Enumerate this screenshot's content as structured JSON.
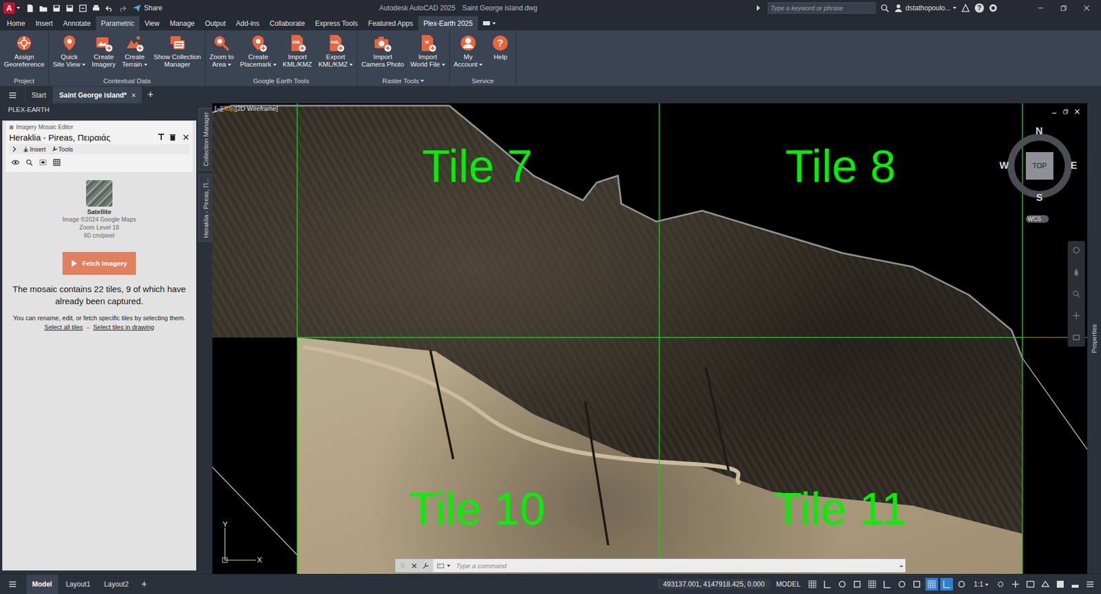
{
  "title_bar": {
    "logo": "A",
    "share": "Share",
    "title": [
      "Autodesk AutoCAD 2025",
      "Saint George island.dwg"
    ],
    "search_placeholder": "Type a keyword or phrase",
    "user": "dstathopoulo...",
    "help": "?"
  },
  "ribbon_tabs": [
    {
      "label": "Home",
      "selected": false,
      "highlighted": false
    },
    {
      "label": "Insert",
      "selected": false,
      "highlighted": false
    },
    {
      "label": "Annotate",
      "selected": false,
      "highlighted": false
    },
    {
      "label": "Parametric",
      "selected": false,
      "highlighted": true
    },
    {
      "label": "View",
      "selected": false,
      "highlighted": false
    },
    {
      "label": "Manage",
      "selected": false,
      "highlighted": false
    },
    {
      "label": "Output",
      "selected": false,
      "highlighted": false
    },
    {
      "label": "Add-ins",
      "selected": false,
      "highlighted": false
    },
    {
      "label": "Collaborate",
      "selected": false,
      "highlighted": false
    },
    {
      "label": "Express Tools",
      "selected": false,
      "highlighted": false
    },
    {
      "label": "Featured Apps",
      "selected": false,
      "highlighted": false
    },
    {
      "label": "Plex-Earth 2025",
      "selected": true,
      "highlighted": false
    }
  ],
  "ribbon_groups": [
    {
      "title": "Project",
      "dropdown": false,
      "buttons": [
        {
          "lines": [
            "Assign",
            "Georeference"
          ],
          "dropdown": false
        }
      ]
    },
    {
      "title": "Contextual Data",
      "dropdown": false,
      "buttons": [
        {
          "lines": [
            "Quick",
            "Site View"
          ],
          "dropdown": true
        },
        {
          "lines": [
            "Create",
            "Imagery"
          ],
          "dropdown": false
        },
        {
          "lines": [
            "Create",
            "Terrain"
          ],
          "dropdown": true
        },
        {
          "lines": [
            "Show Collection",
            "Manager"
          ],
          "dropdown": false
        }
      ]
    },
    {
      "title": "Google Earth Tools",
      "dropdown": false,
      "buttons": [
        {
          "lines": [
            "Zoom to",
            "Area"
          ],
          "dropdown": true
        },
        {
          "lines": [
            "Create",
            "Placemark"
          ],
          "dropdown": true
        },
        {
          "lines": [
            "Import",
            "KML/KMZ"
          ],
          "dropdown": false,
          "badge": "KML"
        },
        {
          "lines": [
            "Export",
            "KML/KMZ"
          ],
          "dropdown": true,
          "badge": "KML"
        }
      ]
    },
    {
      "title": "Raster Tools",
      "dropdown": true,
      "buttons": [
        {
          "lines": [
            "Import",
            "Camera Photo"
          ],
          "dropdown": false
        },
        {
          "lines": [
            "Import",
            "World File"
          ],
          "dropdown": true,
          "badge": "W"
        }
      ]
    },
    {
      "title": "Service",
      "dropdown": false,
      "buttons": [
        {
          "lines": [
            "My",
            "Account"
          ],
          "dropdown": true
        },
        {
          "lines": [
            "Help"
          ],
          "dropdown": false,
          "glyph": "?"
        }
      ]
    }
  ],
  "file_tabs": {
    "tabs": [
      {
        "label": "Start",
        "selected": false,
        "closable": false
      },
      {
        "label": "Saint George island*",
        "selected": true,
        "closable": true
      }
    ],
    "close": "×",
    "add": "+"
  },
  "palette": {
    "title": "PLEX-EARTH",
    "editor": {
      "caption": "Imagery Mosaic Editor",
      "name": "Heraklia - Pireas, Πειραιάς",
      "close": "×",
      "tools": [
        "Insert",
        "Tools"
      ]
    },
    "source": {
      "name": "Satellite",
      "credit": "Image ©2024 Google Maps",
      "zoom": "Zoom Level 18",
      "resolution": "60 cm/pixel"
    },
    "fetch_button": "Fetch imagery",
    "summary": "The mosaic contains 22 tiles, 9 of which have already been captured.",
    "hint": "You can rename, edit, or fetch specific tiles by selecting them.",
    "links": [
      "Select all tiles",
      "Select tiles in drawing"
    ],
    "link_separator": "-"
  },
  "side_tabs": [
    "Collection Manager",
    "Heraklia - Pireas, Π..."
  ],
  "viewport": {
    "controls": [
      {
        "label": "[−]",
        "highlighted": false
      },
      {
        "label": "[Top]",
        "highlighted": true
      },
      {
        "label": "[2D Wireframe]",
        "highlighted": false
      }
    ],
    "tiles": [
      "Tile 7",
      "Tile 8",
      "Tile 10",
      "Tile 11"
    ],
    "viewcube": {
      "north": "N",
      "east": "E",
      "south": "S",
      "west": "W",
      "face": "TOP",
      "ucs": "WCS"
    },
    "ucs_axes": [
      "Y",
      "X"
    ],
    "command_placeholder": "Type a command"
  },
  "properties_tab": "Properties",
  "status_bar": {
    "layouts": [
      {
        "label": "Model",
        "selected": true
      },
      {
        "label": "Layout1",
        "selected": false
      },
      {
        "label": "Layout2",
        "selected": false
      }
    ],
    "add": "+",
    "coordinates": "493137.001, 4147918.425, 0.000",
    "space": "MODEL",
    "toggles": [
      {
        "on": false
      },
      {
        "on": false
      },
      {
        "on": false
      },
      {
        "on": false
      },
      {
        "on": false
      },
      {
        "on": false
      },
      {
        "on": false
      },
      {
        "on": false
      },
      {
        "on": true
      },
      {
        "on": true
      },
      {
        "on": false
      }
    ],
    "scale": "1:1"
  }
}
